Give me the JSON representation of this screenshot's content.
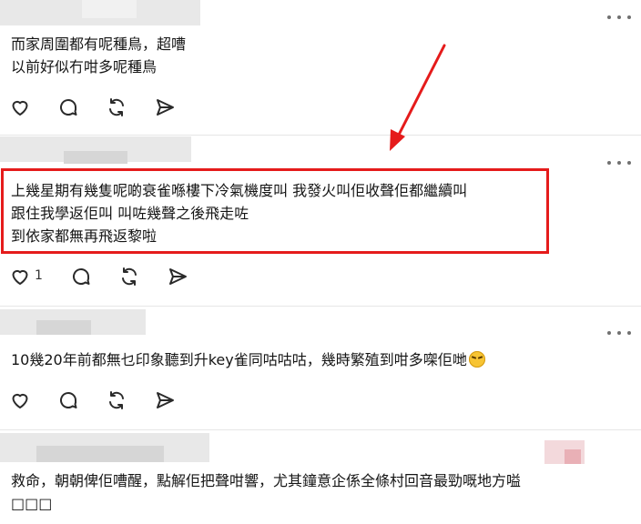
{
  "posts": [
    {
      "lines": [
        "而家周圍都有呢種鳥，超嘈",
        "以前好似冇咁多呢種鳥"
      ],
      "like_count": ""
    },
    {
      "lines": [
        "上幾星期有幾隻呢啲衰雀喺樓下冷氣機度叫 我發火叫佢收聲佢都繼續叫",
        "跟住我學返佢叫 叫咗幾聲之後飛走咗",
        "到依家都無再飛返黎啦"
      ],
      "like_count": "1"
    },
    {
      "lines": [
        "10幾20年前都無乜印象聽到升key雀同咕咕咕，幾時繁殖到咁多㗎佢哋"
      ],
      "emoji": "laughing-face-icon",
      "like_count": ""
    },
    {
      "lines": [
        "救命，朝朝俾佢嘈醒，點解佢把聲咁響，尤其鐘意企係全條村回音最勁嘅地方嗌",
        "□□□"
      ],
      "like_count": ""
    }
  ],
  "colors": {
    "highlight": "#e51b1b",
    "text": "#151515",
    "icon": "#2a2a2a"
  }
}
